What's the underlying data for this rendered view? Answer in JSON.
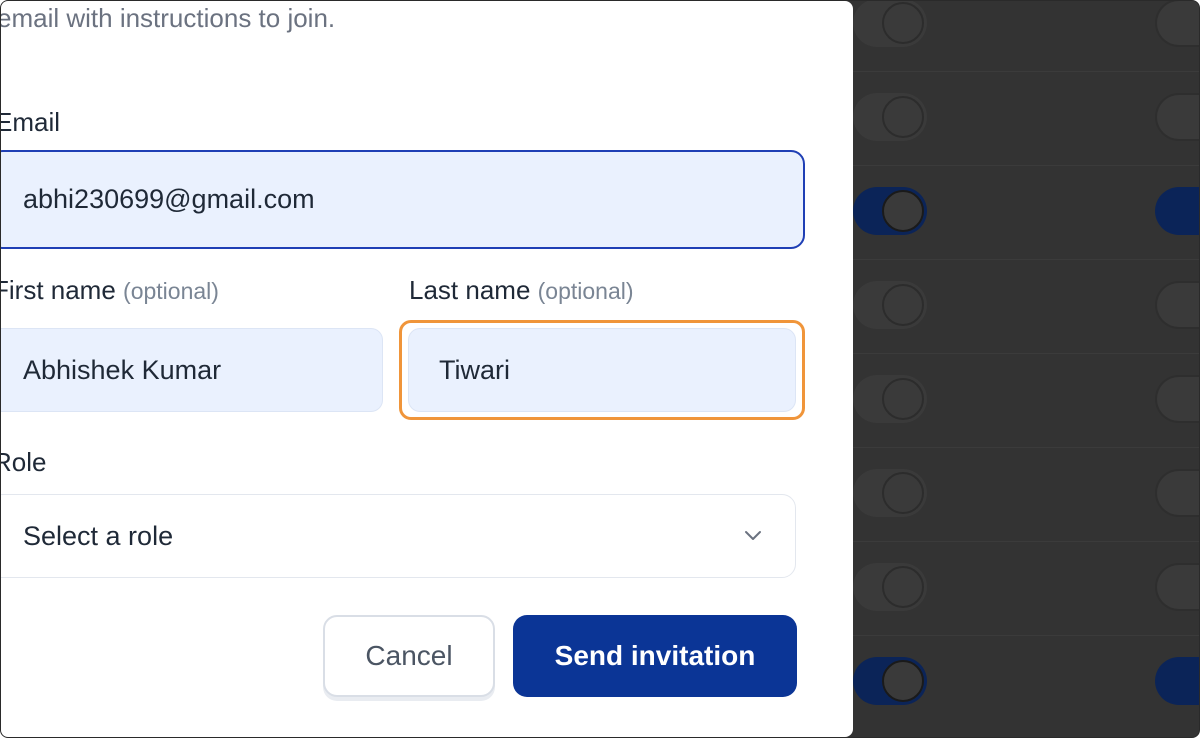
{
  "modal": {
    "intro_text": "email with instructions to join.",
    "email": {
      "label": "Email",
      "value": "abhi230699@gmail.com"
    },
    "first_name": {
      "label": "First name",
      "optional": "(optional)",
      "value": "Abhishek Kumar"
    },
    "last_name": {
      "label": "Last name",
      "optional": "(optional)",
      "value": "Tiwari"
    },
    "role": {
      "label": "Role",
      "selected": "Select a role"
    },
    "buttons": {
      "cancel": "Cancel",
      "send": "Send invitation"
    }
  },
  "colors": {
    "primary": "#0b3596",
    "field_bg": "#eaf1fe",
    "focus_border": "#1f3fb5",
    "highlight": "#f0953a",
    "overlay": "#333333"
  },
  "icons": {
    "role_dropdown": "chevron-down-icon"
  }
}
